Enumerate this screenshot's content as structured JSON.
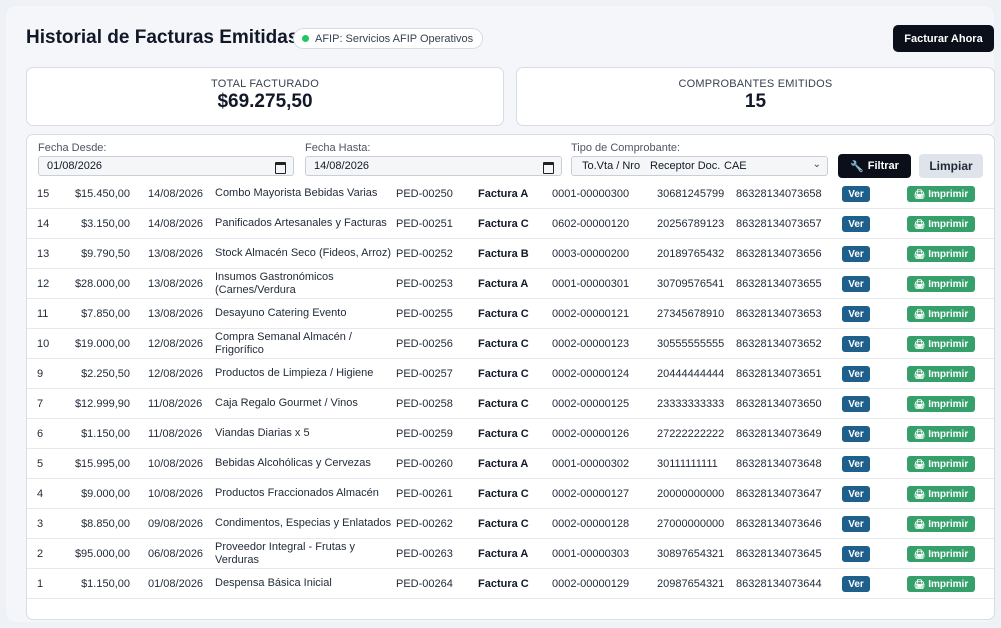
{
  "header": {
    "title": "Historial de Facturas Emitidas",
    "afip_status": "AFIP: Servicios AFIP Operativos",
    "facturar_label": "Facturar Ahora"
  },
  "summary": {
    "total_label": "TOTAL FACTURADO",
    "total_value": "$69.275,50",
    "count_label": "COMPROBANTES EMITIDOS",
    "count_value": "15"
  },
  "filters": {
    "desde_label": "Fecha Desde:",
    "desde_value": "01/08/2026",
    "hasta_label": "Fecha Hasta:",
    "hasta_value": "14/08/2026",
    "tipo_label": "Tipo de Comprobante:",
    "tipo_col1": "To.Vta / Nro",
    "tipo_col2": "Receptor Doc.",
    "tipo_col3": "CAE",
    "filtrar_label": "Filtrar",
    "limpiar_label": "Limpiar"
  },
  "actions": {
    "ver_label": "Ver",
    "imprimir_label": "Imprimir"
  },
  "rows": [
    {
      "num": "15",
      "amount": "$15.450,00",
      "date": "14/08/2026",
      "desc": "Combo Mayorista Bebidas Varias",
      "ped": "PED-00250",
      "tipo": "Factura A",
      "comp": "0001-00000300",
      "receptor": "30681245799",
      "cae": "86328134073658"
    },
    {
      "num": "14",
      "amount": "$3.150,00",
      "date": "14/08/2026",
      "desc": "Panificados Artesanales y Facturas",
      "ped": "PED-00251",
      "tipo": "Factura C",
      "comp": "0602-00000120",
      "receptor": "20256789123",
      "cae": "86328134073657"
    },
    {
      "num": "13",
      "amount": "$9.790,50",
      "date": "13/08/2026",
      "desc": "Stock Almacén Seco (Fideos, Arroz)",
      "ped": "PED-00252",
      "tipo": "Factura B",
      "comp": "0003-00000200",
      "receptor": "20189765432",
      "cae": "86328134073656"
    },
    {
      "num": "12",
      "amount": "$28.000,00",
      "date": "13/08/2026",
      "desc": "Insumos Gastronómicos (Carnes/Verdura",
      "ped": "PED-00253",
      "tipo": "Factura A",
      "comp": "0001-00000301",
      "receptor": "30709576541",
      "cae": "86328134073655"
    },
    {
      "num": "11",
      "amount": "$7.850,00",
      "date": "13/08/2026",
      "desc": "Desayuno Catering Evento",
      "ped": "PED-00255",
      "tipo": "Factura C",
      "comp": "0002-00000121",
      "receptor": "27345678910",
      "cae": "86328134073653"
    },
    {
      "num": "10",
      "amount": "$19.000,00",
      "date": "12/08/2026",
      "desc": "Compra Semanal Almacén / Frigorífico",
      "ped": "PED-00256",
      "tipo": "Factura C",
      "comp": "0002-00000123",
      "receptor": "30555555555",
      "cae": "86328134073652"
    },
    {
      "num": "9",
      "amount": "$2.250,50",
      "date": "12/08/2026",
      "desc": "Productos de Limpieza / Higiene",
      "ped": "PED-00257",
      "tipo": "Factura C",
      "comp": "0002-00000124",
      "receptor": "20444444444",
      "cae": "86328134073651"
    },
    {
      "num": "7",
      "amount": "$12.999,90",
      "date": "11/08/2026",
      "desc": "Caja Regalo Gourmet / Vinos",
      "ped": "PED-00258",
      "tipo": "Factura C",
      "comp": "0002-00000125",
      "receptor": "23333333333",
      "cae": "86328134073650"
    },
    {
      "num": "6",
      "amount": "$1.150,00",
      "date": "11/08/2026",
      "desc": "Viandas Diarias x 5",
      "ped": "PED-00259",
      "tipo": "Factura C",
      "comp": "0002-00000126",
      "receptor": "27222222222",
      "cae": "86328134073649"
    },
    {
      "num": "5",
      "amount": "$15.995,00",
      "date": "10/08/2026",
      "desc": "Bebidas Alcohólicas y Cervezas",
      "ped": "PED-00260",
      "tipo": "Factura A",
      "comp": "0001-00000302",
      "receptor": "30111111111",
      "cae": "86328134073648"
    },
    {
      "num": "4",
      "amount": "$9.000,00",
      "date": "10/08/2026",
      "desc": "Productos Fraccionados Almacén",
      "ped": "PED-00261",
      "tipo": "Factura C",
      "comp": "0002-00000127",
      "receptor": "20000000000",
      "cae": "86328134073647"
    },
    {
      "num": "3",
      "amount": "$8.850,00",
      "date": "09/08/2026",
      "desc": "Condimentos, Especias y Enlatados",
      "ped": "PED-00262",
      "tipo": "Factura C",
      "comp": "0002-00000128",
      "receptor": "27000000000",
      "cae": "86328134073646"
    },
    {
      "num": "2",
      "amount": "$95.000,00",
      "date": "06/08/2026",
      "desc": "Proveedor Integral - Frutas y Verduras",
      "ped": "PED-00263",
      "tipo": "Factura A",
      "comp": "0001-00000303",
      "receptor": "30897654321",
      "cae": "86328134073645"
    },
    {
      "num": "1",
      "amount": "$1.150,00",
      "date": "01/08/2026",
      "desc": "Despensa Básica Inicial",
      "ped": "PED-00264",
      "tipo": "Factura C",
      "comp": "0002-00000129",
      "receptor": "20987654321",
      "cae": "86328134073644"
    }
  ]
}
